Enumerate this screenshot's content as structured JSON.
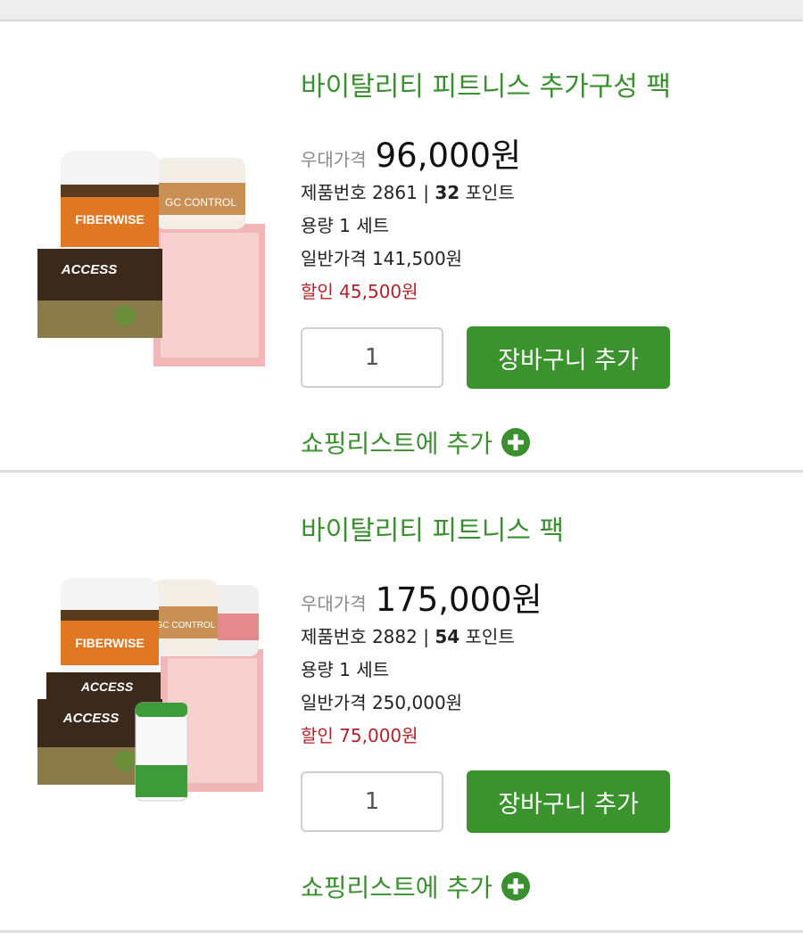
{
  "products": [
    {
      "title": "바이탈리티 피트니스 추가구성 팩",
      "member_price_label": "우대가격",
      "member_price": "96,000원",
      "product_no_label": "제품번호 2861 | ",
      "points_value": "32",
      "points_label": " 포인트",
      "volume": "용량 1 세트",
      "regular_price": "일반가격 141,500원",
      "discount": "할인 45,500원",
      "quantity": "1",
      "cart_button": "장바구니 추가",
      "shopping_list": "쇼핑리스트에 추가",
      "image_labels": [
        "FIBERWISE",
        "ACCESS",
        "GC CONTROL"
      ]
    },
    {
      "title": "바이탈리티 피트니스 팩",
      "member_price_label": "우대가격",
      "member_price": "175,000원",
      "product_no_label": "제품번호 2882 | ",
      "points_value": "54",
      "points_label": " 포인트",
      "volume": "용량 1 세트",
      "regular_price": "일반가격 250,000원",
      "discount": "할인 75,000원",
      "quantity": "1",
      "cart_button": "장바구니 추가",
      "shopping_list": "쇼핑리스트에 추가",
      "image_labels": [
        "FIBERWISE",
        "ACCESS",
        "ACCESS",
        "GC CONTROL"
      ]
    }
  ],
  "colors": {
    "accent_green": "#3a8f2f",
    "button_green": "#3a932c",
    "discount_red": "#b0232a"
  }
}
